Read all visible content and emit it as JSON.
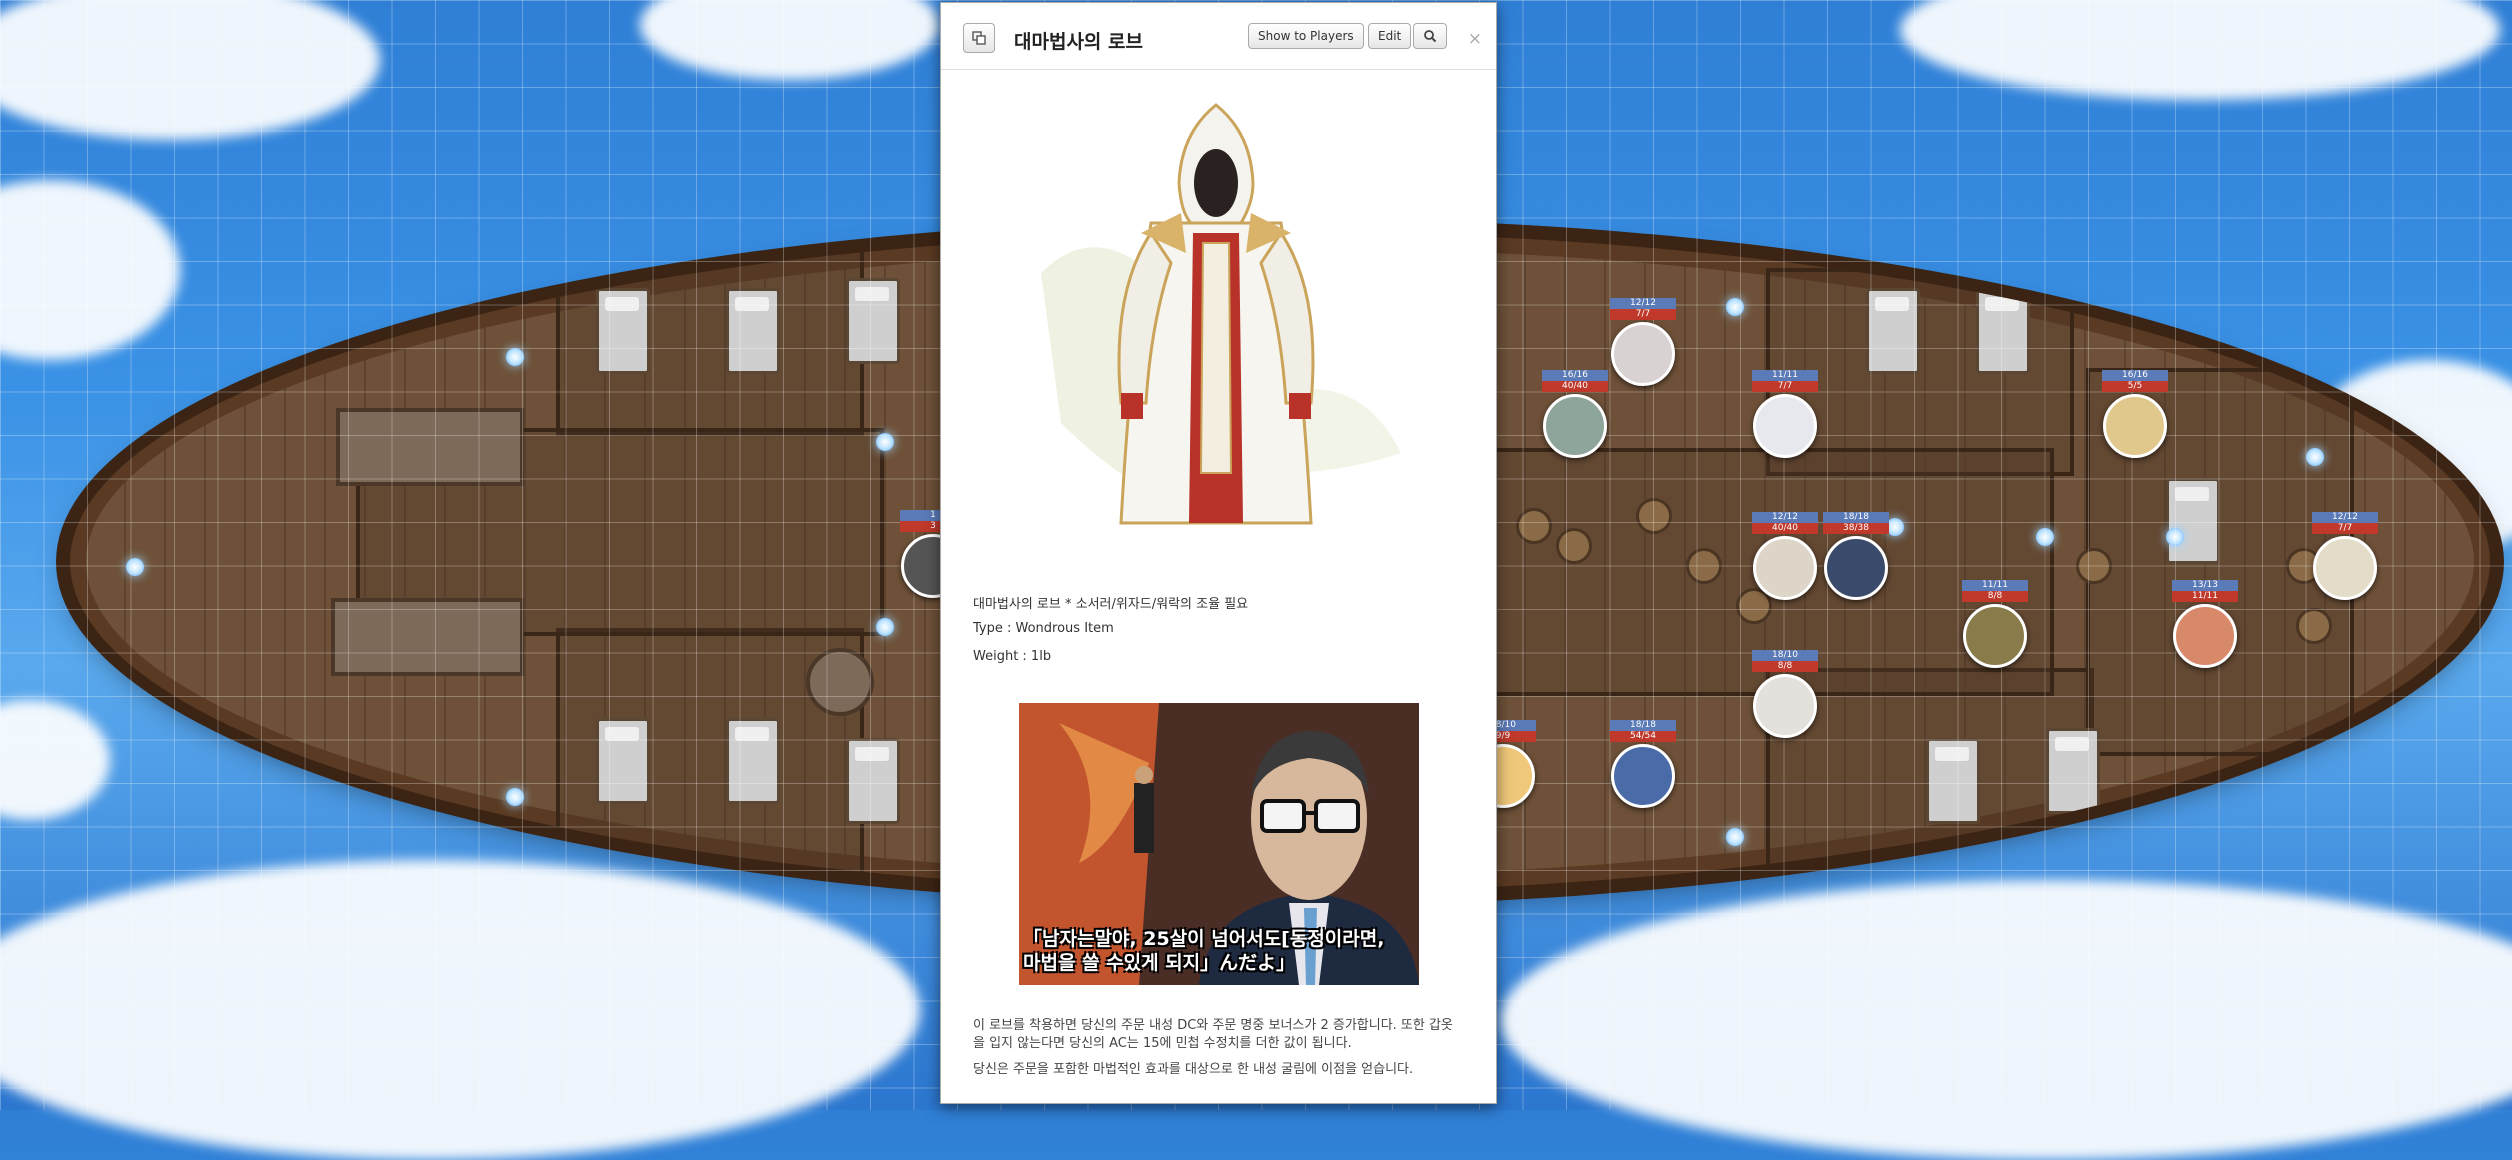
{
  "dialog": {
    "title": "대마법사의 로브",
    "buttons": {
      "show_players": "Show to Players",
      "edit": "Edit",
      "search_icon": "search-icon"
    },
    "close": "×",
    "item_line": "대마법사의 로브 * 소서러/위자드/워락의 조율 필요",
    "type_line": "Type : Wondrous Item",
    "weight_line": "Weight : 1lb",
    "meme_caption": "「남자는말야, 25살이 넘어서도[동정이라면,\n마법을 쓸 수있게 되지」んだよ」",
    "desc_1": "이 로브를 착용하면 당신의 주문 내성 DC와 주문 명중 보너스가 2 증가합니다. 또한 갑옷을 입지 않는다면 당신의 AC는 15에 민첩 수정치를 더한 값이 됩니다.",
    "desc_2": "당신은 주문을 포함한 마법적인 효과를 대상으로 한 내성 굴림에 이점을 얻습니다."
  },
  "tokens": [
    {
      "top": "12/12",
      "bottom": "7/7",
      "color": "#d9d2d2"
    },
    {
      "top": "16/16",
      "bottom": "40/40",
      "color": "#8ea59b"
    },
    {
      "top": "11/11",
      "bottom": "7/7",
      "color": "#e7e7ee"
    },
    {
      "top": "16/16",
      "bottom": "5/5",
      "color": "#e0c88c"
    },
    {
      "top": "12/12",
      "bottom": "40/40",
      "color": "#ddd5c8"
    },
    {
      "top": "18/18",
      "bottom": "38/38",
      "color": "#3a4a6a"
    },
    {
      "top": "11/11",
      "bottom": "8/8",
      "color": "#8a7c4a"
    },
    {
      "top": "13/13",
      "bottom": "11/11",
      "color": "#d8896a"
    },
    {
      "top": "12/12",
      "bottom": "7/7",
      "color": "#e2dcc8"
    },
    {
      "top": "18/10",
      "bottom": "8/8",
      "color": "#e4e0dc"
    },
    {
      "top": "18/10",
      "bottom": "9/9",
      "color": "#f0c87a"
    },
    {
      "top": "18/18",
      "bottom": "54/54",
      "color": "#4a6aa8"
    },
    {
      "top": "1",
      "bottom": "3",
      "color": "#555555"
    }
  ]
}
